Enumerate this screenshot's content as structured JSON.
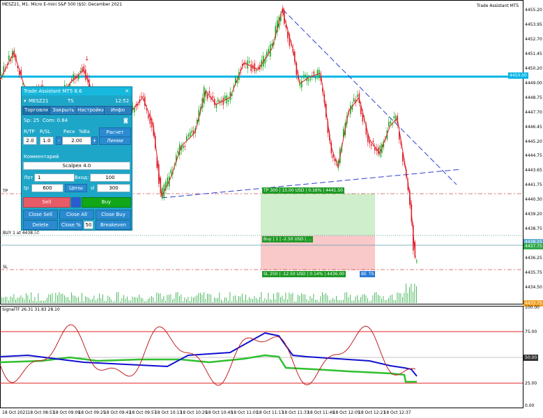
{
  "chart_header": {
    "title": "MESZ21, M1:  Micro E-mini S&P 500 ($S): December 2021",
    "assistant_label": "Trade Assistant MT5"
  },
  "price_axis": {
    "labels": [
      "4455.20",
      "4453.95",
      "4452.70",
      "4451.45",
      "4450.20",
      "4449.00",
      "4448.75",
      "4447.70",
      "4446.45",
      "4445.20",
      "4444.75",
      "4443.65",
      "4441.75",
      "4440.30",
      "4439.20",
      "4438.75",
      "4437.50",
      "4436.25",
      "4435.75",
      "4434.50"
    ],
    "marker_4450": "4450.00",
    "marker_blue": "4438.25",
    "marker_green": "4437.75",
    "marker_orange": "4433.75"
  },
  "chart_lines": {
    "tp_label": "TP",
    "sl_label": "SL",
    "buy_label": "BUY 1 at 4438.50"
  },
  "zones": {
    "tp": "TP 300 | 15.00 USD | 0.16% | 4441.50",
    "buy": "Buy | 1 | -2.50 USD | ...",
    "sl": "SL 250 | -12.50 USD | 0.14% | 4436.00",
    "be": "BE",
    "ts": "TS"
  },
  "indicator": {
    "label": "SignalTF 26.31 31.83 28.10",
    "levels": [
      "100.00",
      "75.00",
      "50.00",
      "25.00",
      "0.00"
    ],
    "level_50_marker": "50.00"
  },
  "time_axis": [
    "18 Oct 2021",
    "18 Oct 08:53",
    "18 Oct 09:09",
    "18 Oct 09:25",
    "18 Oct 09:41",
    "18 Oct 09:57",
    "18 Oct 10:13",
    "18 Oct 10:29",
    "18 Oct 10:45",
    "18 Oct 11:01",
    "18 Oct 11:17",
    "18 Oct 11:33",
    "18 Oct 11:49",
    "18 Oct 12:05",
    "18 Oct 12:21",
    "18 Oct 12:37"
  ],
  "panel": {
    "title": "Trade Assistant MT5 8.6",
    "symbol": "MESZ21",
    "ts": "TS",
    "time": "12:52",
    "tabs": [
      "Торговля",
      "Закрыть",
      "Настройки",
      "Инфо"
    ],
    "spread": "Sp: 25",
    "commission": "Com: 0.84",
    "rtp": "R/TP",
    "rsl": "R/SL",
    "risk": "Риск",
    "pct_bal": "%Ba",
    "calc_lot": "Расчет лота",
    "rtp_value": "2.0",
    "rsl_value": "1.0",
    "risk_value": "2.00",
    "minus": "-",
    "plus": "+",
    "lines_btn": "Линии",
    "comment_label": "Комментарий",
    "comment_value": "Scalpex 4.0",
    "lot_label": "Лот",
    "lot_value": "1",
    "entry_label": "Вход:",
    "entry_value": "100",
    "tp_label": "tp",
    "tp_value": "600",
    "prices_btn": "Цены",
    "sl_label": "sl",
    "sl_value": "300",
    "sell": "Sell",
    "buy": "Buy",
    "close_sell": "Close Sell",
    "close_all": "Close All",
    "close_buy": "Close Buy",
    "delete_orders": "Delete Orders",
    "close_pct": "Close %",
    "close_pct_value": "50",
    "breakeven": "Breakeven"
  },
  "colors": {
    "up_candle": "#12a619",
    "down_candle": "#e0202a",
    "level_line": "#00b4e6",
    "trend_line": "#2f3ecf",
    "tp_zone": "#cfeecb",
    "sl_zone": "#f9c9c9"
  }
}
